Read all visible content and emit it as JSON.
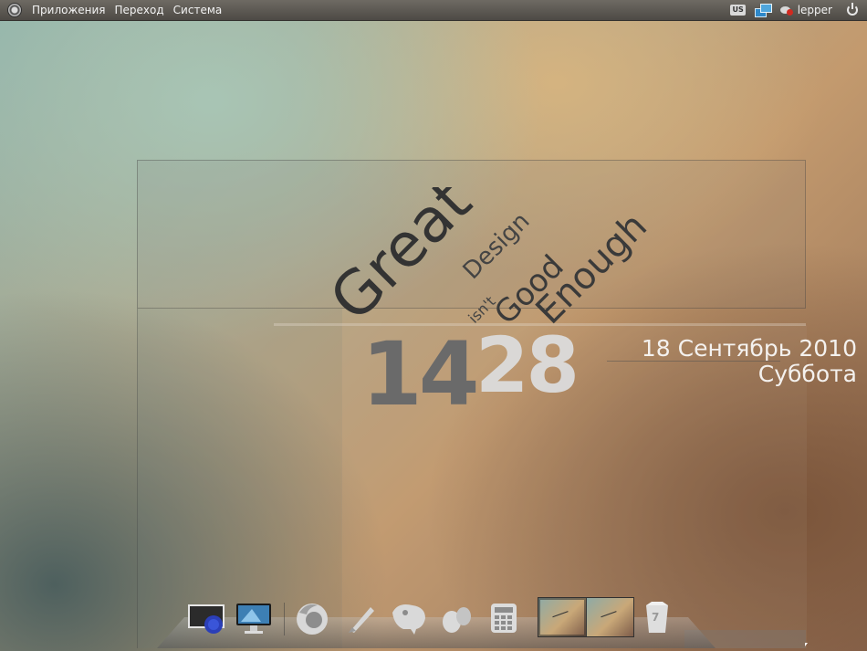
{
  "top_panel": {
    "menus": [
      "Приложения",
      "Переход",
      "Система"
    ],
    "keyboard_layout": "US",
    "username": "lepper",
    "icons": [
      "gnome-foot-icon",
      "network-icon",
      "user-status-icon",
      "power-icon"
    ]
  },
  "wallpaper_text": {
    "line1": "Great",
    "line2": "Design",
    "line3": "isn't",
    "line4": "Good",
    "line5": "Enough"
  },
  "clock": {
    "hours": "14",
    "minutes": "28",
    "date": "18 Сентябрь 2010",
    "weekday": "Суббота"
  },
  "dock": {
    "items": [
      {
        "name": "window-list-icon"
      },
      {
        "name": "monitor-icon"
      },
      {
        "name": "firefox-icon"
      },
      {
        "name": "inkscape-icon"
      },
      {
        "name": "gimp-icon"
      },
      {
        "name": "pidgin-icon"
      },
      {
        "name": "calculator-icon"
      },
      {
        "name": "workspace-switcher"
      },
      {
        "name": "trash-icon"
      }
    ],
    "trash_count": "7",
    "workspaces": 2
  },
  "colors": {
    "panel": "#5b5852",
    "accent_red": "#d12a20",
    "net_blue": "#2e88c9",
    "clock_hours": "#6a6a6a",
    "clock_minutes": "#dcdcdc"
  }
}
